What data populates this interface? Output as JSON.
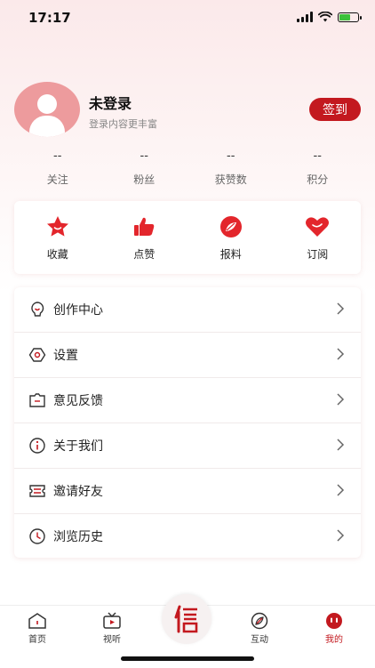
{
  "status_bar": {
    "time": "17:17"
  },
  "profile": {
    "name": "未登录",
    "subtitle": "登录内容更丰富",
    "signin_label": "签到"
  },
  "stats": [
    {
      "value": "--",
      "label": "关注"
    },
    {
      "value": "--",
      "label": "粉丝"
    },
    {
      "value": "--",
      "label": "获赞数"
    },
    {
      "value": "--",
      "label": "积分"
    }
  ],
  "quick_actions": [
    {
      "label": "收藏",
      "icon": "star-icon"
    },
    {
      "label": "点赞",
      "icon": "thumbs-up-icon"
    },
    {
      "label": "报料",
      "icon": "tip-compass-icon"
    },
    {
      "label": "订阅",
      "icon": "heart-icon"
    }
  ],
  "menu": [
    {
      "label": "创作中心",
      "icon": "bulb-icon"
    },
    {
      "label": "设置",
      "icon": "settings-icon"
    },
    {
      "label": "意见反馈",
      "icon": "feedback-icon"
    },
    {
      "label": "关于我们",
      "icon": "info-icon"
    },
    {
      "label": "邀请好友",
      "icon": "ticket-icon"
    },
    {
      "label": "浏览历史",
      "icon": "clock-icon"
    }
  ],
  "bottom_nav": [
    {
      "label": "首页",
      "icon": "home-icon"
    },
    {
      "label": "视听",
      "icon": "tv-icon"
    },
    {
      "label": "信",
      "icon": "xin-logo-icon"
    },
    {
      "label": "互动",
      "icon": "compass-icon"
    },
    {
      "label": "我的",
      "icon": "profile-face-icon"
    }
  ],
  "colors": {
    "accent": "#c3191f",
    "star": "#e3262c",
    "avatar_bg": "#ed9b9d"
  }
}
